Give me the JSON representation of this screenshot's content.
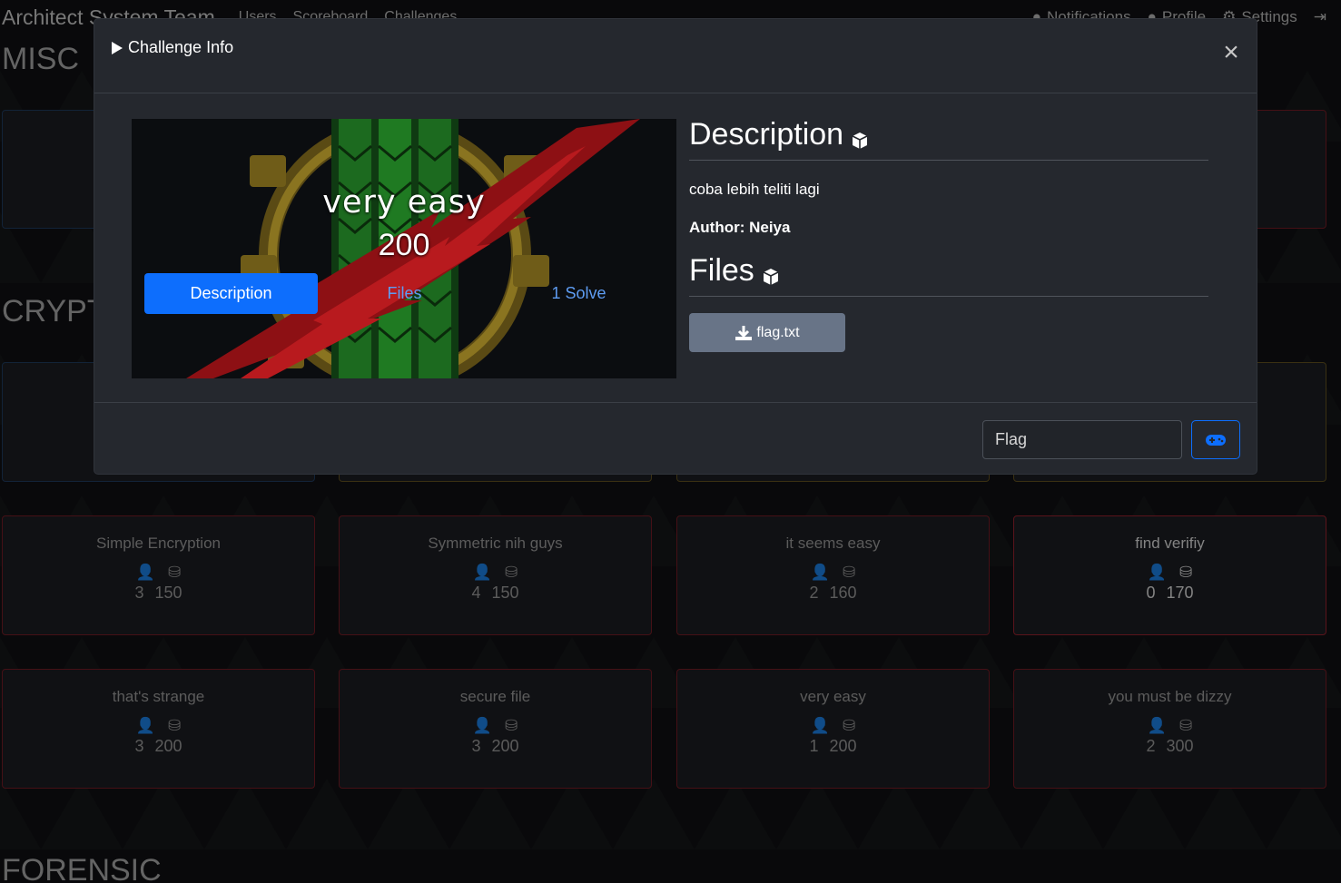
{
  "navbar": {
    "brand": "Architect System Team",
    "links": [
      "Users",
      "Scoreboard",
      "Challenges"
    ],
    "right": [
      "Notifications",
      "Profile",
      "Settings"
    ]
  },
  "sections": {
    "misc": "MISC",
    "crypto": "CRYPTO",
    "forensic": "FORENSIC"
  },
  "cards_row1": [
    {
      "title": "Simple Encryption",
      "solves": "3",
      "points": "150"
    },
    {
      "title": "Symmetric nih guys",
      "solves": "4",
      "points": "150"
    },
    {
      "title": "it seems easy",
      "solves": "2",
      "points": "160"
    },
    {
      "title": "find verifiy",
      "solves": "0",
      "points": "170"
    }
  ],
  "cards_row2": [
    {
      "title": "that's strange",
      "solves": "3",
      "points": "200"
    },
    {
      "title": "secure file",
      "solves": "3",
      "points": "200"
    },
    {
      "title": "very easy",
      "solves": "1",
      "points": "200"
    },
    {
      "title": "you must be dizzy",
      "solves": "2",
      "points": "300"
    }
  ],
  "modal": {
    "title": "Challenge Info",
    "close": "×",
    "banner_title": "very easy",
    "banner_points": "200",
    "tabs": {
      "description": "Description",
      "files": "Files",
      "solves": "1 Solve"
    },
    "description_heading": "Description",
    "description_text": "coba lebih teliti lagi",
    "author": "Author: Neiya",
    "files_heading": "Files",
    "file_name": "flag.txt",
    "flag_placeholder": "Flag"
  },
  "colors": {
    "primary": "#0d6efd",
    "modal_bg": "#25282e",
    "file_button": "#687487"
  }
}
